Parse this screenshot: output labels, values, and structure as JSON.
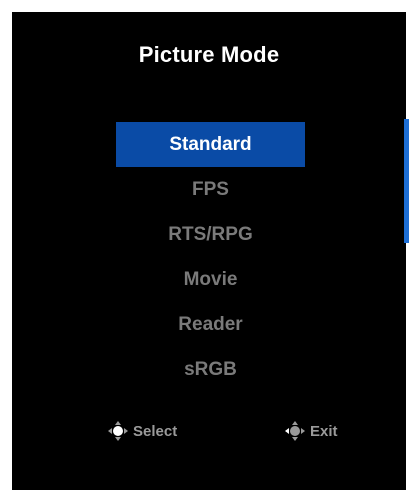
{
  "osd": {
    "title": "Picture Mode",
    "options": [
      {
        "label": "Standard",
        "selected": true
      },
      {
        "label": "FPS",
        "selected": false
      },
      {
        "label": "RTS/RPG",
        "selected": false
      },
      {
        "label": "Movie",
        "selected": false
      },
      {
        "label": "Reader",
        "selected": false
      },
      {
        "label": "sRGB",
        "selected": false
      }
    ],
    "hints": {
      "select": {
        "label": "Select",
        "icon": "joystick-press-icon"
      },
      "exit": {
        "label": "Exit",
        "icon": "joystick-left-icon"
      }
    }
  },
  "colors": {
    "panel_background": "#000000",
    "selected_background": "#0a4ba6",
    "scrollbar": "#1d6fd6",
    "unselected_text": "#7a7a7a"
  }
}
